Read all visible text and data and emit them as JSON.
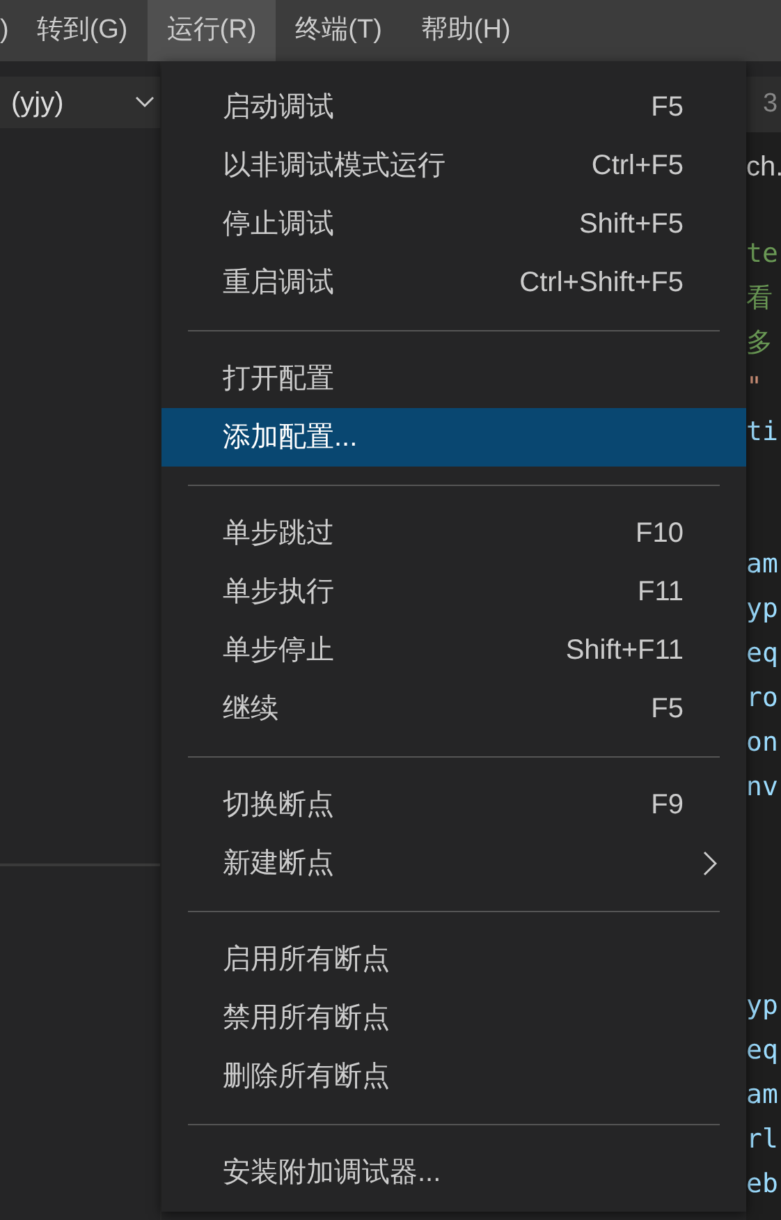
{
  "menu_bar": [
    {
      "label": ")",
      "selected": false
    },
    {
      "label": "转到(G)",
      "selected": false
    },
    {
      "label": "运行(R)",
      "selected": true
    },
    {
      "label": "终端(T)",
      "selected": false
    },
    {
      "label": "帮助(H)",
      "selected": false
    }
  ],
  "sidebar": {
    "dropdown": "(yjy)"
  },
  "run_menu": {
    "groups": [
      [
        {
          "kind": "item",
          "label": "启动调试",
          "shortcut": "F5",
          "selected": false
        },
        {
          "kind": "item",
          "label": "以非调试模式运行",
          "shortcut": "Ctrl+F5",
          "selected": false
        },
        {
          "kind": "item",
          "label": "停止调试",
          "shortcut": "Shift+F5",
          "selected": false
        },
        {
          "kind": "item",
          "label": "重启调试",
          "shortcut": "Ctrl+Shift+F5",
          "selected": false
        }
      ],
      [
        {
          "kind": "item",
          "label": "打开配置",
          "selected": false
        },
        {
          "kind": "item",
          "label": "添加配置...",
          "selected": true
        }
      ],
      [
        {
          "kind": "item",
          "label": "单步跳过",
          "shortcut": "F10",
          "selected": false
        },
        {
          "kind": "item",
          "label": "单步执行",
          "shortcut": "F11",
          "selected": false
        },
        {
          "kind": "item",
          "label": "单步停止",
          "shortcut": "Shift+F11",
          "selected": false
        },
        {
          "kind": "item",
          "label": "继续",
          "shortcut": "F5",
          "selected": false
        }
      ],
      [
        {
          "kind": "item",
          "label": "切换断点",
          "shortcut": "F9",
          "selected": false
        },
        {
          "kind": "submenu",
          "label": "新建断点",
          "selected": false
        }
      ],
      [
        {
          "kind": "item",
          "label": "启用所有断点",
          "selected": false
        },
        {
          "kind": "item",
          "label": "禁用所有断点",
          "selected": false
        },
        {
          "kind": "item",
          "label": "删除所有断点",
          "selected": false
        }
      ],
      [
        {
          "kind": "item",
          "label": "安装附加调试器...",
          "selected": false
        }
      ]
    ]
  },
  "editor": {
    "top_tab": "3",
    "file_tab": "ch.",
    "code_blocks": [
      [
        {
          "text": "te",
          "color": "#6a9955"
        },
        {
          "text": "看",
          "color": "#6a9955"
        },
        {
          "text": "多",
          "color": "#6a9955"
        },
        {
          "text": "\"",
          "color": "#ce9178"
        },
        {
          "text": "ti",
          "color": "#9cdcfe"
        }
      ],
      [
        {
          "text": "am",
          "color": "#9cdcfe"
        },
        {
          "text": "yp",
          "color": "#9cdcfe"
        },
        {
          "text": "eq",
          "color": "#9cdcfe"
        },
        {
          "text": "ro",
          "color": "#9cdcfe"
        },
        {
          "text": "on",
          "color": "#9cdcfe"
        },
        {
          "text": "nv",
          "color": "#9cdcfe"
        }
      ],
      [
        {
          "text": "yp",
          "color": "#9cdcfe"
        },
        {
          "text": "eq",
          "color": "#9cdcfe"
        },
        {
          "text": "am",
          "color": "#9cdcfe"
        },
        {
          "text": "rl",
          "color": "#9cdcfe"
        },
        {
          "text": "eb",
          "color": "#9cdcfe"
        }
      ]
    ]
  }
}
